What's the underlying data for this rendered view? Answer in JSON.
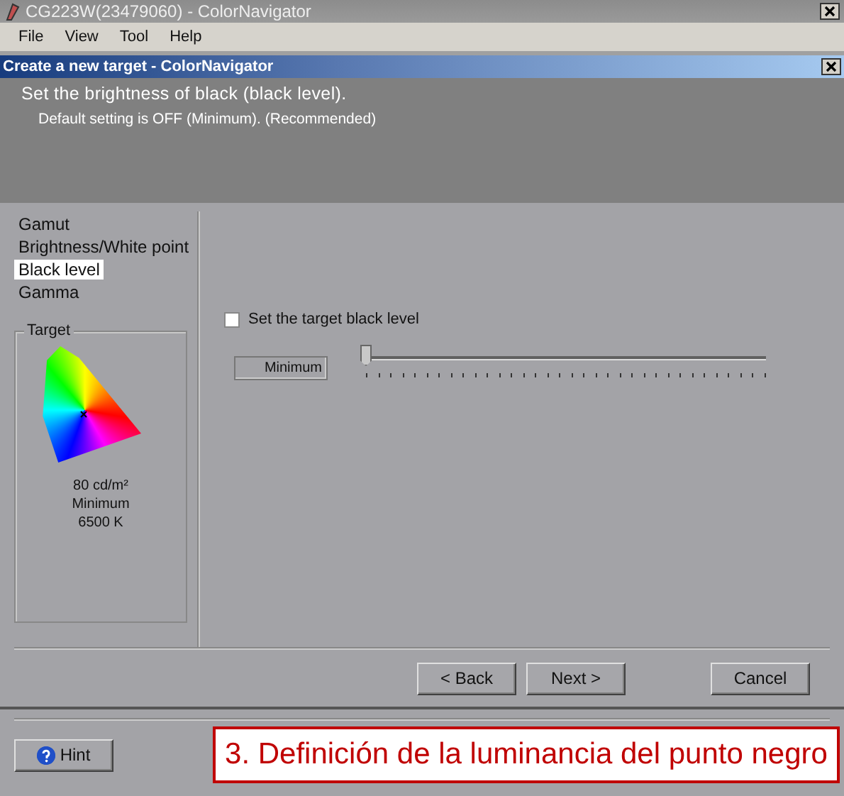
{
  "window": {
    "title": "CG223W(23479060) - ColorNavigator"
  },
  "menu": [
    "File",
    "View",
    "Tool",
    "Help"
  ],
  "dialog": {
    "title": "Create a new target - ColorNavigator",
    "heading": "Set the brightness of black (black level).",
    "subheading": "Default setting is OFF (Minimum). (Recommended)"
  },
  "steps": [
    {
      "label": "Gamut",
      "selected": false
    },
    {
      "label": "Brightness/White point",
      "selected": false
    },
    {
      "label": "Black level",
      "selected": true
    },
    {
      "label": "Gamma",
      "selected": false
    }
  ],
  "target": {
    "title": "Target",
    "lines": [
      "80 cd/m²",
      "Minimum",
      "6500 K"
    ]
  },
  "black_level": {
    "label": "Set the target black level",
    "checked": false,
    "value": "Minimum",
    "level": 0
  },
  "buttons": [
    "< Back",
    "Next >",
    "Cancel"
  ],
  "hint_button": "Hint",
  "caption": "3. Definición de la luminancia del punto negro"
}
